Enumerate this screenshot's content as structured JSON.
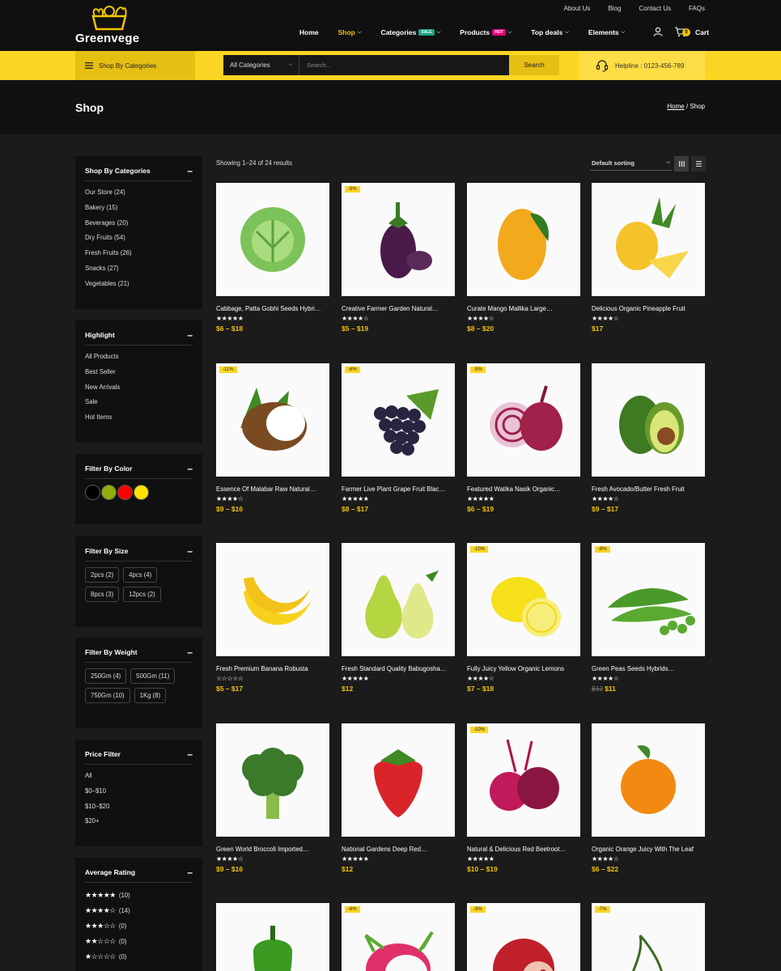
{
  "header": {
    "logo_text": "Greenvege",
    "top_links": [
      "About Us",
      "Blog",
      "Contact Us",
      "FAQs"
    ],
    "nav": [
      {
        "label": "Home",
        "badge": "",
        "chevron": false,
        "active": false
      },
      {
        "label": "Shop",
        "badge": "",
        "chevron": true,
        "active": true
      },
      {
        "label": "Categories",
        "badge": "SALE",
        "chevron": true,
        "active": false
      },
      {
        "label": "Products",
        "badge": "HOT",
        "chevron": true,
        "active": false
      },
      {
        "label": "Top deals",
        "badge": "",
        "chevron": true,
        "active": false
      },
      {
        "label": "Elements",
        "badge": "",
        "chevron": true,
        "active": false
      }
    ],
    "cart_label": "Cart",
    "cart_count": "0"
  },
  "searchbar": {
    "shop_by_categories": "Shop By Categories",
    "category_select": "All Categories",
    "placeholder": "Search...",
    "button": "Search",
    "helpline": "Helpline : 0123-456-789"
  },
  "page": {
    "title": "Shop",
    "breadcrumb_home": "Home",
    "breadcrumb_sep": "/",
    "breadcrumb_current": "Shop"
  },
  "sidebar": {
    "categories": {
      "title": "Shop By Categories",
      "items": [
        "Our Store (24)",
        "Bakery (15)",
        "Beverages (20)",
        "Dry Fruits (54)",
        "Fresh Fruits (26)",
        "Snacks (27)",
        "Vegetables (21)"
      ]
    },
    "highlight": {
      "title": "Highlight",
      "items": [
        "All Products",
        "Best Seller",
        "New Arrivals",
        "Sale",
        "Hot Items"
      ]
    },
    "color": {
      "title": "Filter By Color",
      "swatches": [
        "#000000",
        "#8fae0b",
        "#ff0000",
        "#ffe100"
      ]
    },
    "size": {
      "title": "Filter By Size",
      "items": [
        "2pcs (2)",
        "4pcs (4)",
        "8pcs (3)",
        "12pcs (2)"
      ]
    },
    "weight": {
      "title": "Filter By Weight",
      "items": [
        "250Gm (4)",
        "500Gm (11)",
        "750Gm (10)",
        "1Kg (8)"
      ]
    },
    "price": {
      "title": "Price Filter",
      "items": [
        "All",
        "$0–$10",
        "$10–$20",
        "$20+"
      ]
    },
    "rating": {
      "title": "Average Rating",
      "items": [
        {
          "stars": 5,
          "count": "(10)"
        },
        {
          "stars": 4,
          "count": "(14)"
        },
        {
          "stars": 3,
          "count": "(0)"
        },
        {
          "stars": 2,
          "count": "(0)"
        },
        {
          "stars": 1,
          "count": "(0)"
        }
      ]
    }
  },
  "toolbar": {
    "showing": "Showing 1–24 of 24 results",
    "sort": "Default sorting"
  },
  "products": [
    {
      "name": "Cabbage, Patta Gobhi Seeds Hybri…",
      "stars": 5,
      "price": "$6 – $18",
      "old_price": "",
      "discount": "",
      "icon": "cabbage",
      "color": "#7cc35a"
    },
    {
      "name": "Creative Farmer Garden Natural…",
      "stars": 4,
      "price": "$5 – $19",
      "old_price": "",
      "discount": "-5%",
      "icon": "eggplant",
      "color": "#4a1a4a"
    },
    {
      "name": "Curate Mango Mallika Large…",
      "stars": 4,
      "price": "$8 – $20",
      "old_price": "",
      "discount": "",
      "icon": "mango",
      "color": "#f2a91c"
    },
    {
      "name": "Delicious Organic Pineapple Fruit",
      "stars": 4,
      "price": "$17",
      "old_price": "",
      "discount": "",
      "icon": "pineapple",
      "color": "#f5c22a"
    },
    {
      "name": "Essence Of Malabar Raw Natural…",
      "stars": 4,
      "price": "$9 – $16",
      "old_price": "",
      "discount": "-11%",
      "icon": "coconut",
      "color": "#7a4a22"
    },
    {
      "name": "Farmer Live Plant Grape Fruit Blac…",
      "stars": 5,
      "price": "$8 – $17",
      "old_price": "",
      "discount": "-6%",
      "icon": "grapes",
      "color": "#2a2440"
    },
    {
      "name": "Featured Watika Nasik Organic…",
      "stars": 5,
      "price": "$6 – $19",
      "old_price": "",
      "discount": "-5%",
      "icon": "onion",
      "color": "#a0214a"
    },
    {
      "name": "Fresh Avocado/Butter Fresh Fruit",
      "stars": 4,
      "price": "$9 – $17",
      "old_price": "",
      "discount": "",
      "icon": "avocado",
      "color": "#3d7a22"
    },
    {
      "name": "Fresh Premium Banana Robusta",
      "stars": 0,
      "price": "$5 – $17",
      "old_price": "",
      "discount": "",
      "icon": "banana",
      "color": "#f7d21c"
    },
    {
      "name": "Fresh Standard Quality Babugosha…",
      "stars": 5,
      "price": "$12",
      "old_price": "",
      "discount": "",
      "icon": "pear",
      "color": "#b5d640"
    },
    {
      "name": "Fully Juicy Yellow Organic Lemons",
      "stars": 4,
      "price": "$7 – $18",
      "old_price": "",
      "discount": "-10%",
      "icon": "lemon",
      "color": "#f6e01a"
    },
    {
      "name": "Green Peas Seeds Hybrids…",
      "stars": 4,
      "price": "$11",
      "old_price": "$12",
      "discount": "-8%",
      "icon": "peas",
      "color": "#4a9a2a"
    },
    {
      "name": "Green World Broccoli Imported…",
      "stars": 4,
      "price": "$9 – $16",
      "old_price": "",
      "discount": "",
      "icon": "broccoli",
      "color": "#3a7a2a"
    },
    {
      "name": "National Gardens Deep Red…",
      "stars": 5,
      "price": "$12",
      "old_price": "",
      "discount": "",
      "icon": "strawberry",
      "color": "#d9252a"
    },
    {
      "name": "Natural & Delicious Red Beetroot…",
      "stars": 5,
      "price": "$10 – $19",
      "old_price": "",
      "discount": "-10%",
      "icon": "beetroot",
      "color": "#8a1540"
    },
    {
      "name": "Organic Orange Juicy With The Leaf",
      "stars": 4,
      "price": "$6 – $22",
      "old_price": "",
      "discount": "",
      "icon": "orange",
      "color": "#f28a12"
    },
    {
      "name": "",
      "stars": 0,
      "price": "",
      "old_price": "",
      "discount": "",
      "icon": "pepper",
      "color": "#3a9a22"
    },
    {
      "name": "",
      "stars": 0,
      "price": "",
      "old_price": "",
      "discount": "-6%",
      "icon": "dragonfruit",
      "color": "#e0306a"
    },
    {
      "name": "",
      "stars": 0,
      "price": "",
      "old_price": "",
      "discount": "-9%",
      "icon": "pomegranate",
      "color": "#c0202a"
    },
    {
      "name": "",
      "stars": 0,
      "price": "",
      "old_price": "",
      "discount": "-7%",
      "icon": "cherry",
      "color": "#8a0a14"
    }
  ]
}
